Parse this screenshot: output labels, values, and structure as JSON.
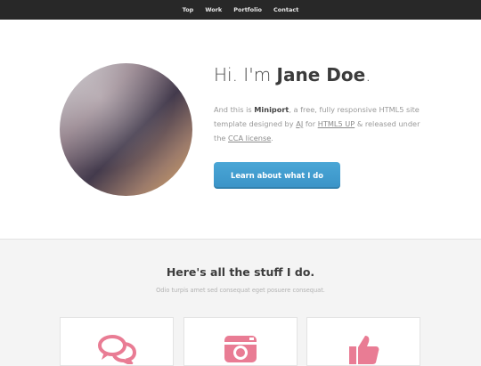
{
  "nav": {
    "items": [
      {
        "label": "Top"
      },
      {
        "label": "Work"
      },
      {
        "label": "Portfolio"
      },
      {
        "label": "Contact"
      }
    ]
  },
  "hero": {
    "greeting": "Hi. I'm ",
    "name": "Jane Doe",
    "period": ".",
    "text_intro": "And this is ",
    "brand": "Miniport",
    "text_mid": ", a free, fully responsive HTML5 site template designed by ",
    "author_link": "AJ",
    "text_for": " for ",
    "site_link": "HTML5 UP",
    "text_release": " & released under the ",
    "license_link": "CCA license",
    "text_end": ".",
    "cta_label": "Learn about what I do"
  },
  "work": {
    "title": "Here's all the stuff I do.",
    "subtitle": "Odio turpis amet sed consequat eget posuere consequat.",
    "cards": [
      {
        "icon": "comments-icon"
      },
      {
        "icon": "camera-icon"
      },
      {
        "icon": "thumbs-up-icon"
      }
    ]
  },
  "colors": {
    "nav_bg": "#282828",
    "accent": "#3a93c7",
    "icon": "#e97c94"
  }
}
